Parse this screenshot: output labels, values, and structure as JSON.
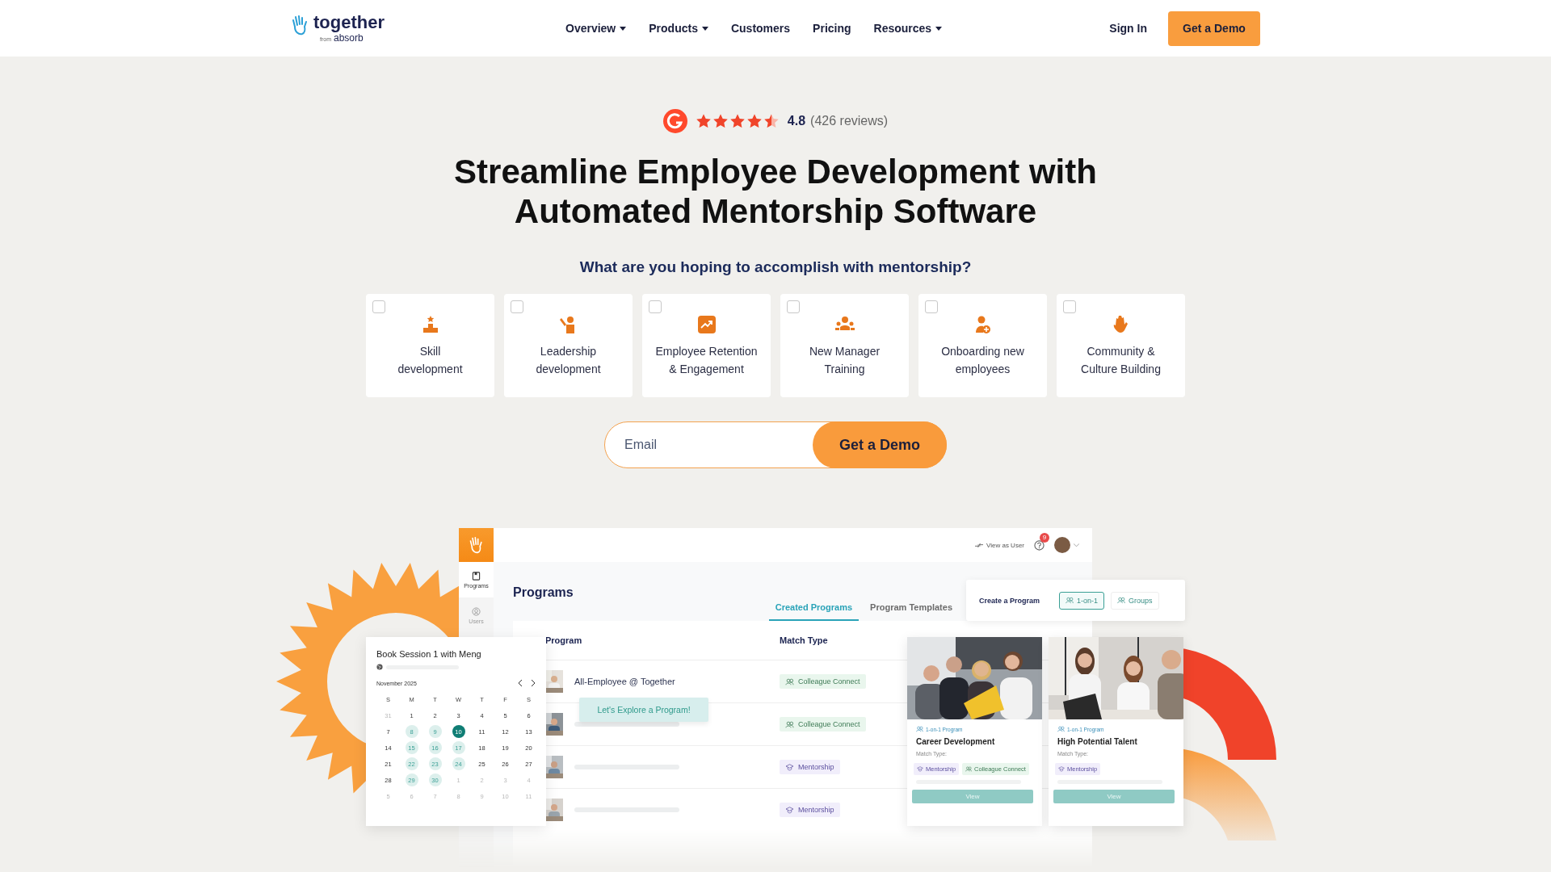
{
  "header": {
    "logo": {
      "name": "together",
      "from": "from",
      "brand": "absorb"
    },
    "nav": [
      {
        "label": "Overview",
        "dropdown": true
      },
      {
        "label": "Products",
        "dropdown": true
      },
      {
        "label": "Customers",
        "dropdown": false
      },
      {
        "label": "Pricing",
        "dropdown": false
      },
      {
        "label": "Resources",
        "dropdown": true
      }
    ],
    "sign_in": "Sign In",
    "cta": "Get a Demo"
  },
  "rating": {
    "stars": 4.5,
    "score": "4.8",
    "count": "(426 reviews)"
  },
  "title": "Streamline Employee Development with Automated Mentorship Software",
  "question": "What are you hoping to accomplish with mentorship?",
  "goals": [
    {
      "label": "Skill\ndevelopment",
      "checked": false
    },
    {
      "label": "Leadership\ndevelopment",
      "checked": false
    },
    {
      "label": "Employee Retention\n& Engagement",
      "checked": false
    },
    {
      "label": "New Manager\nTraining",
      "checked": false
    },
    {
      "label": "Onboarding new\nemployees",
      "checked": false
    },
    {
      "label": "Community &\nCulture Building",
      "checked": false
    }
  ],
  "signup": {
    "placeholder": "Email",
    "button": "Get a Demo"
  },
  "app": {
    "sidebar": [
      {
        "label": "Programs",
        "selected": true
      },
      {
        "label": "Users",
        "selected": false
      }
    ],
    "topbar": {
      "view_as": "View as User",
      "notifications": "9"
    },
    "title": "Programs",
    "tabs": [
      {
        "label": "Created Programs",
        "selected": true
      },
      {
        "label": "Program Templates",
        "selected": false
      }
    ],
    "create_menu": {
      "label": "Create a Program",
      "options": [
        {
          "label": "1-on-1",
          "selected": true
        },
        {
          "label": "Groups",
          "selected": false
        }
      ]
    },
    "table": {
      "columns": [
        "Program",
        "Match Type"
      ],
      "rows": [
        {
          "name": "All-Employee @ Together",
          "match_type": {
            "label": "Colleague Connect",
            "kind": "colleague"
          }
        },
        {
          "match_type": {
            "label": "Colleague Connect",
            "kind": "colleague"
          }
        },
        {
          "match_type": {
            "label": "Mentorship",
            "kind": "mentorship"
          }
        },
        {
          "match_type": {
            "label": "Mentorship",
            "kind": "mentorship"
          }
        }
      ]
    },
    "tooltip": "Let's Explore a Program!",
    "calendar": {
      "title": "Book Session 1 with Meng",
      "month": "November 2025",
      "weekdays": [
        "S",
        "M",
        "T",
        "W",
        "T",
        "F",
        "S"
      ],
      "weeks": [
        [
          {
            "day": "31",
            "outside": true,
            "available": false,
            "selected": false
          },
          {
            "day": "1",
            "outside": false,
            "available": false,
            "selected": false
          },
          {
            "day": "2",
            "outside": false,
            "available": false,
            "selected": false
          },
          {
            "day": "3",
            "outside": false,
            "available": false,
            "selected": false
          },
          {
            "day": "4",
            "outside": false,
            "available": false,
            "selected": false
          },
          {
            "day": "5",
            "outside": false,
            "available": false,
            "selected": false
          },
          {
            "day": "6",
            "outside": false,
            "available": false,
            "selected": false
          }
        ],
        [
          {
            "day": "7",
            "outside": false,
            "available": false,
            "selected": false
          },
          {
            "day": "8",
            "outside": false,
            "available": true,
            "selected": false
          },
          {
            "day": "9",
            "outside": false,
            "available": true,
            "selected": false
          },
          {
            "day": "10",
            "outside": false,
            "available": true,
            "selected": true
          },
          {
            "day": "11",
            "outside": false,
            "available": false,
            "selected": false
          },
          {
            "day": "12",
            "outside": false,
            "available": false,
            "selected": false
          },
          {
            "day": "13",
            "outside": false,
            "available": false,
            "selected": false
          }
        ],
        [
          {
            "day": "14",
            "outside": false,
            "available": false,
            "selected": false
          },
          {
            "day": "15",
            "outside": false,
            "available": true,
            "selected": false
          },
          {
            "day": "16",
            "outside": false,
            "available": true,
            "selected": false
          },
          {
            "day": "17",
            "outside": false,
            "available": true,
            "selected": false
          },
          {
            "day": "18",
            "outside": false,
            "available": false,
            "selected": false
          },
          {
            "day": "19",
            "outside": false,
            "available": false,
            "selected": false
          },
          {
            "day": "20",
            "outside": false,
            "available": false,
            "selected": false
          }
        ],
        [
          {
            "day": "21",
            "outside": false,
            "available": false,
            "selected": false
          },
          {
            "day": "22",
            "outside": false,
            "available": true,
            "selected": false
          },
          {
            "day": "23",
            "outside": false,
            "available": true,
            "selected": false
          },
          {
            "day": "24",
            "outside": false,
            "available": true,
            "selected": false
          },
          {
            "day": "25",
            "outside": false,
            "available": false,
            "selected": false
          },
          {
            "day": "26",
            "outside": false,
            "available": false,
            "selected": false
          },
          {
            "day": "27",
            "outside": false,
            "available": false,
            "selected": false
          }
        ],
        [
          {
            "day": "28",
            "outside": false,
            "available": false,
            "selected": false
          },
          {
            "day": "29",
            "outside": false,
            "available": true,
            "selected": false
          },
          {
            "day": "30",
            "outside": false,
            "available": true,
            "selected": false
          },
          {
            "day": "1",
            "outside": true,
            "available": false,
            "selected": false
          },
          {
            "day": "2",
            "outside": true,
            "available": false,
            "selected": false
          },
          {
            "day": "3",
            "outside": true,
            "available": false,
            "selected": false
          },
          {
            "day": "4",
            "outside": true,
            "available": false,
            "selected": false
          }
        ],
        [
          {
            "day": "5",
            "outside": true,
            "available": false,
            "selected": false
          },
          {
            "day": "6",
            "outside": true,
            "available": false,
            "selected": false
          },
          {
            "day": "7",
            "outside": true,
            "available": false,
            "selected": false
          },
          {
            "day": "8",
            "outside": true,
            "available": false,
            "selected": false
          },
          {
            "day": "9",
            "outside": true,
            "available": false,
            "selected": false
          },
          {
            "day": "10",
            "outside": true,
            "available": false,
            "selected": false
          },
          {
            "day": "11",
            "outside": true,
            "available": false,
            "selected": false
          }
        ]
      ]
    },
    "program_cards": [
      {
        "type": "1-on-1 Program",
        "title": "Career Development",
        "match_label": "Match Type:",
        "match_types": [
          {
            "label": "Mentorship",
            "kind": "mentorship"
          },
          {
            "label": "Colleague Connect",
            "kind": "colleague"
          }
        ],
        "button": "View"
      },
      {
        "type": "1-on-1 Program",
        "title": "High Potential Talent",
        "match_label": "Match Type:",
        "match_types": [
          {
            "label": "Mentorship",
            "kind": "mentorship"
          }
        ],
        "button": "View"
      }
    ]
  }
}
